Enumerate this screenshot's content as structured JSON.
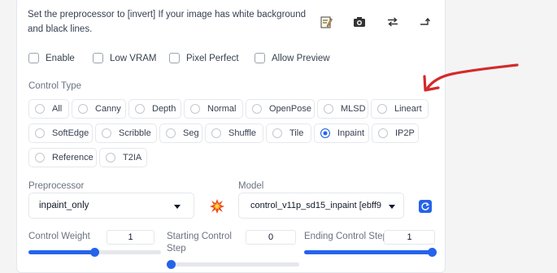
{
  "instructions": "Set the preprocessor to [invert] If your image has white background and black lines.",
  "toolbar": {
    "icons": [
      "edit-icon",
      "camera-icon",
      "swap-icon",
      "send-icon"
    ]
  },
  "options": [
    {
      "label": "Enable",
      "checked": false
    },
    {
      "label": "Low VRAM",
      "checked": false
    },
    {
      "label": "Pixel Perfect",
      "checked": false
    },
    {
      "label": "Allow Preview",
      "checked": false
    }
  ],
  "control_type": {
    "label": "Control Type",
    "items": [
      "All",
      "Canny",
      "Depth",
      "Normal",
      "OpenPose",
      "MLSD",
      "Lineart",
      "SoftEdge",
      "Scribble",
      "Seg",
      "Shuffle",
      "Tile",
      "Inpaint",
      "IP2P",
      "Reference",
      "T2IA"
    ],
    "selected": "Inpaint"
  },
  "preprocessor": {
    "label": "Preprocessor",
    "value": "inpaint_only"
  },
  "model": {
    "label": "Model",
    "value": "control_v11p_sd15_inpaint [ebff9"
  },
  "control_weight": {
    "label": "Control Weight",
    "value": "1",
    "fraction": 0.5
  },
  "starting_step": {
    "label": "Starting Control Step",
    "value": "0",
    "fraction": 0.0
  },
  "ending_step": {
    "label": "Ending Control Step",
    "value": "1",
    "fraction": 1.0
  },
  "colors": {
    "accent": "#2563eb",
    "annotation": "#d42a2a"
  }
}
